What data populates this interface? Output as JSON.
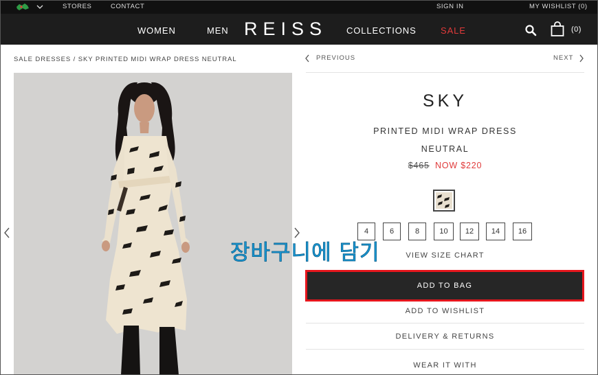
{
  "topbar": {
    "stores": "STORES",
    "contact": "CONTACT",
    "sign_in": "SIGN IN",
    "wishlist": "MY WISHLIST (0)",
    "flag_icon": "country-flag-icon",
    "country_chevron_icon": "chevron-down-icon"
  },
  "nav": {
    "women": "WOMEN",
    "men": "MEN",
    "logo": "REISS",
    "collections": "COLLECTIONS",
    "sale": "SALE",
    "bag_count": "(0)",
    "sale_color": "#e03a3a"
  },
  "breadcrumb": "SALE DRESSES / SKY PRINTED MIDI WRAP DRESS NEUTRAL",
  "product_nav": {
    "previous": "PREVIOUS",
    "next": "NEXT"
  },
  "product": {
    "brand": "SKY",
    "name": "PRINTED MIDI WRAP DRESS",
    "color": "NEUTRAL",
    "price_was": "$465",
    "price_now": "NOW $220",
    "sizes": [
      "4",
      "6",
      "8",
      "10",
      "12",
      "14",
      "16"
    ],
    "size_chart": "VIEW SIZE CHART",
    "add_to_bag": "ADD TO BAG",
    "add_to_wishlist": "ADD TO WISHLIST",
    "delivery_returns": "DELIVERY & RETURNS",
    "wear_it_with": "WEAR IT WITH"
  },
  "annotation": {
    "text": "장바구니에 담기",
    "highlight_color": "#e6161d"
  }
}
